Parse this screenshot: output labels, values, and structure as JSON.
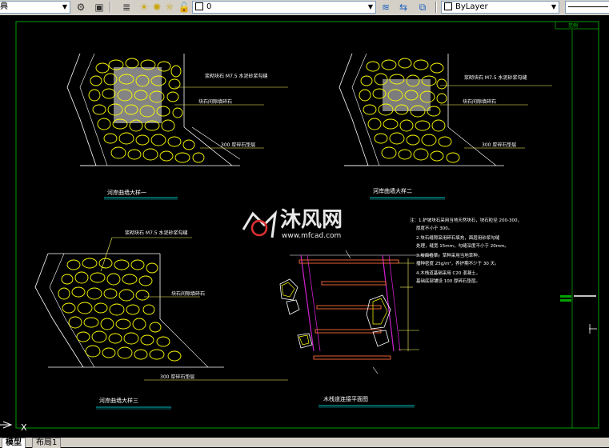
{
  "toolbar": {
    "workspace_value": "典",
    "layer_value": "0",
    "color_value": "ByLayer"
  },
  "drawing": {
    "stamp": "范例",
    "detail_titles": [
      "河岸曲墙大样一",
      "河岸曲墙大样二",
      "河岸曲墙大样三",
      "木栈道连接平面图"
    ],
    "note_lines": [
      "注：1.护坡块石采用当地天然块石，块石粒径 200-300，",
      "厚度不小于 300。",
      "2.块石缝隙采用碎石填充，面层用砂浆勾缝",
      "处理，缝宽 15mm，勾缝深度不小于 20mm。",
      "3.坡面植草，草种采用当地草种，",
      "播种密度 25g/m²，养护期不少于 30 天。",
      "4.木栈道基础采用 C20 混凝土，",
      "基础底部铺设 100 厚碎石垫层。"
    ],
    "leader_texts": [
      "浆砌块石 M7.5 水泥砂浆勾缝",
      "块石间隙填碎石",
      "300 厚碎石垫层"
    ]
  },
  "watermark": {
    "name": "沐风网",
    "url": "www.mfcad.com"
  },
  "tabs": {
    "model": "模型",
    "layout1": "布局1"
  },
  "colors": {
    "canvas": "#000000",
    "frame": "#00a000",
    "stone": "#ffff00",
    "outline": "#ffffff",
    "leader": "#ffff66",
    "title_underline": "#00c0c0",
    "timber": "#ff6a3a",
    "path_edge": "#d020d0"
  }
}
